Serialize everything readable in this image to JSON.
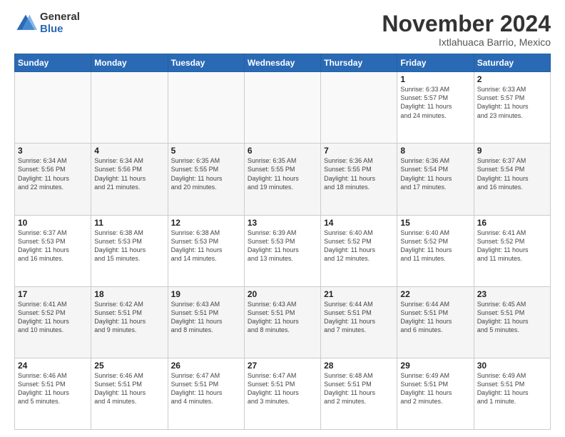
{
  "logo": {
    "general": "General",
    "blue": "Blue"
  },
  "title": "November 2024",
  "subtitle": "Ixtlahuaca Barrio, Mexico",
  "days_header": [
    "Sunday",
    "Monday",
    "Tuesday",
    "Wednesday",
    "Thursday",
    "Friday",
    "Saturday"
  ],
  "weeks": [
    [
      {
        "day": "",
        "info": ""
      },
      {
        "day": "",
        "info": ""
      },
      {
        "day": "",
        "info": ""
      },
      {
        "day": "",
        "info": ""
      },
      {
        "day": "",
        "info": ""
      },
      {
        "day": "1",
        "info": "Sunrise: 6:33 AM\nSunset: 5:57 PM\nDaylight: 11 hours\nand 24 minutes."
      },
      {
        "day": "2",
        "info": "Sunrise: 6:33 AM\nSunset: 5:57 PM\nDaylight: 11 hours\nand 23 minutes."
      }
    ],
    [
      {
        "day": "3",
        "info": "Sunrise: 6:34 AM\nSunset: 5:56 PM\nDaylight: 11 hours\nand 22 minutes."
      },
      {
        "day": "4",
        "info": "Sunrise: 6:34 AM\nSunset: 5:56 PM\nDaylight: 11 hours\nand 21 minutes."
      },
      {
        "day": "5",
        "info": "Sunrise: 6:35 AM\nSunset: 5:55 PM\nDaylight: 11 hours\nand 20 minutes."
      },
      {
        "day": "6",
        "info": "Sunrise: 6:35 AM\nSunset: 5:55 PM\nDaylight: 11 hours\nand 19 minutes."
      },
      {
        "day": "7",
        "info": "Sunrise: 6:36 AM\nSunset: 5:55 PM\nDaylight: 11 hours\nand 18 minutes."
      },
      {
        "day": "8",
        "info": "Sunrise: 6:36 AM\nSunset: 5:54 PM\nDaylight: 11 hours\nand 17 minutes."
      },
      {
        "day": "9",
        "info": "Sunrise: 6:37 AM\nSunset: 5:54 PM\nDaylight: 11 hours\nand 16 minutes."
      }
    ],
    [
      {
        "day": "10",
        "info": "Sunrise: 6:37 AM\nSunset: 5:53 PM\nDaylight: 11 hours\nand 16 minutes."
      },
      {
        "day": "11",
        "info": "Sunrise: 6:38 AM\nSunset: 5:53 PM\nDaylight: 11 hours\nand 15 minutes."
      },
      {
        "day": "12",
        "info": "Sunrise: 6:38 AM\nSunset: 5:53 PM\nDaylight: 11 hours\nand 14 minutes."
      },
      {
        "day": "13",
        "info": "Sunrise: 6:39 AM\nSunset: 5:53 PM\nDaylight: 11 hours\nand 13 minutes."
      },
      {
        "day": "14",
        "info": "Sunrise: 6:40 AM\nSunset: 5:52 PM\nDaylight: 11 hours\nand 12 minutes."
      },
      {
        "day": "15",
        "info": "Sunrise: 6:40 AM\nSunset: 5:52 PM\nDaylight: 11 hours\nand 11 minutes."
      },
      {
        "day": "16",
        "info": "Sunrise: 6:41 AM\nSunset: 5:52 PM\nDaylight: 11 hours\nand 11 minutes."
      }
    ],
    [
      {
        "day": "17",
        "info": "Sunrise: 6:41 AM\nSunset: 5:52 PM\nDaylight: 11 hours\nand 10 minutes."
      },
      {
        "day": "18",
        "info": "Sunrise: 6:42 AM\nSunset: 5:51 PM\nDaylight: 11 hours\nand 9 minutes."
      },
      {
        "day": "19",
        "info": "Sunrise: 6:43 AM\nSunset: 5:51 PM\nDaylight: 11 hours\nand 8 minutes."
      },
      {
        "day": "20",
        "info": "Sunrise: 6:43 AM\nSunset: 5:51 PM\nDaylight: 11 hours\nand 8 minutes."
      },
      {
        "day": "21",
        "info": "Sunrise: 6:44 AM\nSunset: 5:51 PM\nDaylight: 11 hours\nand 7 minutes."
      },
      {
        "day": "22",
        "info": "Sunrise: 6:44 AM\nSunset: 5:51 PM\nDaylight: 11 hours\nand 6 minutes."
      },
      {
        "day": "23",
        "info": "Sunrise: 6:45 AM\nSunset: 5:51 PM\nDaylight: 11 hours\nand 5 minutes."
      }
    ],
    [
      {
        "day": "24",
        "info": "Sunrise: 6:46 AM\nSunset: 5:51 PM\nDaylight: 11 hours\nand 5 minutes."
      },
      {
        "day": "25",
        "info": "Sunrise: 6:46 AM\nSunset: 5:51 PM\nDaylight: 11 hours\nand 4 minutes."
      },
      {
        "day": "26",
        "info": "Sunrise: 6:47 AM\nSunset: 5:51 PM\nDaylight: 11 hours\nand 4 minutes."
      },
      {
        "day": "27",
        "info": "Sunrise: 6:47 AM\nSunset: 5:51 PM\nDaylight: 11 hours\nand 3 minutes."
      },
      {
        "day": "28",
        "info": "Sunrise: 6:48 AM\nSunset: 5:51 PM\nDaylight: 11 hours\nand 2 minutes."
      },
      {
        "day": "29",
        "info": "Sunrise: 6:49 AM\nSunset: 5:51 PM\nDaylight: 11 hours\nand 2 minutes."
      },
      {
        "day": "30",
        "info": "Sunrise: 6:49 AM\nSunset: 5:51 PM\nDaylight: 11 hours\nand 1 minute."
      }
    ]
  ]
}
